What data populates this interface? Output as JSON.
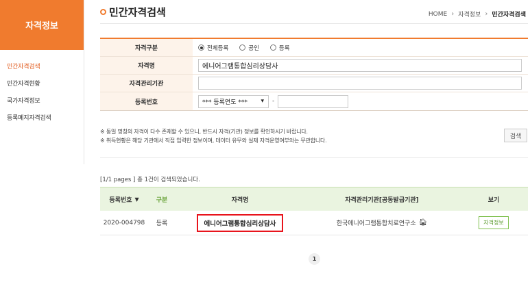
{
  "sidebar": {
    "title": "자격정보",
    "items": [
      {
        "label": "민간자격검색",
        "active": true
      },
      {
        "label": "민간자격현황"
      },
      {
        "label": "국가자격정보"
      },
      {
        "label": "등록폐지자격검색"
      }
    ]
  },
  "header": {
    "title": "민간자격검색",
    "breadcrumb": [
      "HOME",
      "자격정보",
      "민간자격검색"
    ]
  },
  "form": {
    "type_label": "자격구분",
    "type_options": [
      "전체등록",
      "공인",
      "등록"
    ],
    "type_selected": "전체등록",
    "name_label": "자격명",
    "name_value": "에니어그램통합심리상담사",
    "org_label": "자격관리기관",
    "org_value": "",
    "regno_label": "등록번호",
    "regno_select": "*** 등록연도 ***",
    "regno_value": ""
  },
  "notes": [
    "※ 동일 명칭의 자격이 다수 존재할 수 있으니, 반드시 자격(기관) 정보를 확인하시기 바랍니다.",
    "※ 취득현황은 해당 기관에서 직접 입력한 정보이며, 데이터 유무와 실제 자격운영여부와는 무관합니다."
  ],
  "search_button": "검색",
  "results": {
    "summary": "[1/1 pages ] 총 1건이 검색되었습니다.",
    "headers": [
      "등록번호",
      "구분",
      "자격명",
      "자격관리기관[공동발급기관]",
      "보기"
    ],
    "rows": [
      {
        "regno": "2020-004798",
        "type": "등록",
        "name": "에니어그램통합심리상담사",
        "org": "한국에니어그램통합치료연구소",
        "view": "자격정보"
      }
    ]
  },
  "pagination": {
    "current": "1"
  },
  "colors": {
    "accent": "#f07b2e",
    "highlight": "#e8141c",
    "table_header": "#eaf4e0"
  }
}
